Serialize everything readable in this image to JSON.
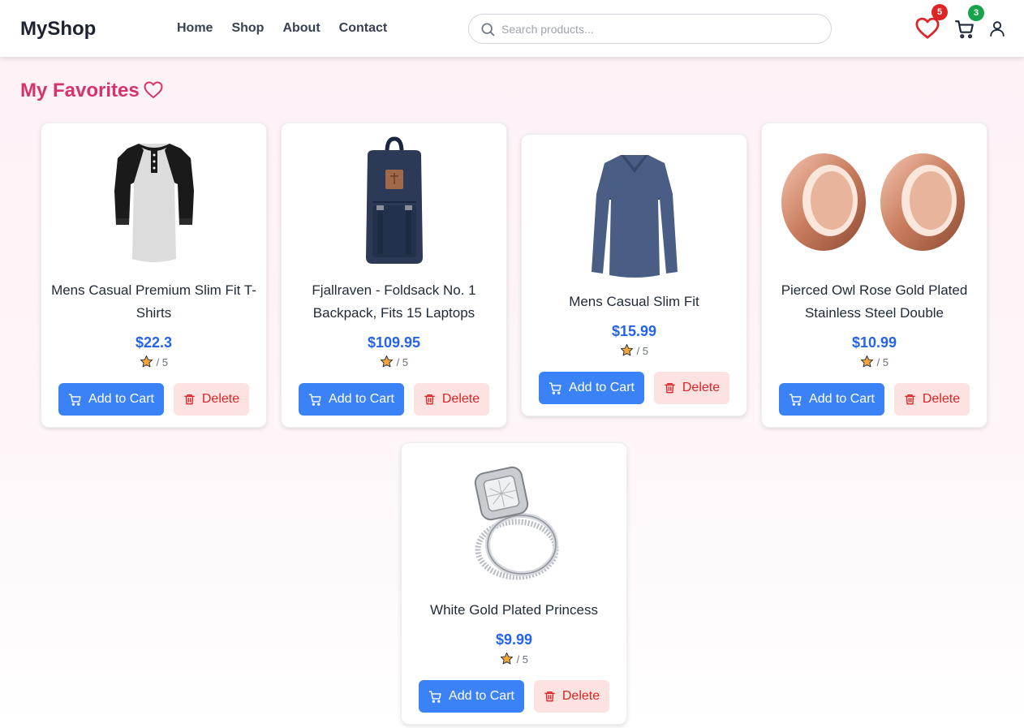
{
  "header": {
    "logo": "MyShop",
    "nav": [
      "Home",
      "Shop",
      "About",
      "Contact"
    ],
    "search_placeholder": "Search products...",
    "favorites_count": "5",
    "cart_count": "3"
  },
  "page": {
    "title": "My Favorites"
  },
  "labels": {
    "add_to_cart": "Add to Cart",
    "delete": "Delete",
    "rating_suffix": "/ 5"
  },
  "products": [
    {
      "name": "Mens Casual Premium Slim Fit T-Shirts",
      "price": "$22.3",
      "image": "raglan-tshirt"
    },
    {
      "name": "Fjallraven - Foldsack No. 1 Backpack, Fits 15 Laptops",
      "price": "$109.95",
      "image": "navy-backpack"
    },
    {
      "name": "Mens Casual Slim Fit",
      "price": "$15.99",
      "image": "blue-long-sleeve-shirt"
    },
    {
      "name": "Pierced Owl Rose Gold Plated Stainless Steel Double",
      "price": "$10.99",
      "image": "rose-gold-plugs"
    },
    {
      "name": "White Gold Plated Princess",
      "price": "$9.99",
      "image": "diamond-ring"
    }
  ],
  "colors": {
    "accent": "#d6336c",
    "price": "#2563eb",
    "cart_button": "#3b82f6",
    "delete_bg": "#fde2e2",
    "delete_text": "#dc2626",
    "badge_favorites": "#dc2626",
    "badge_cart": "#16a34a"
  }
}
